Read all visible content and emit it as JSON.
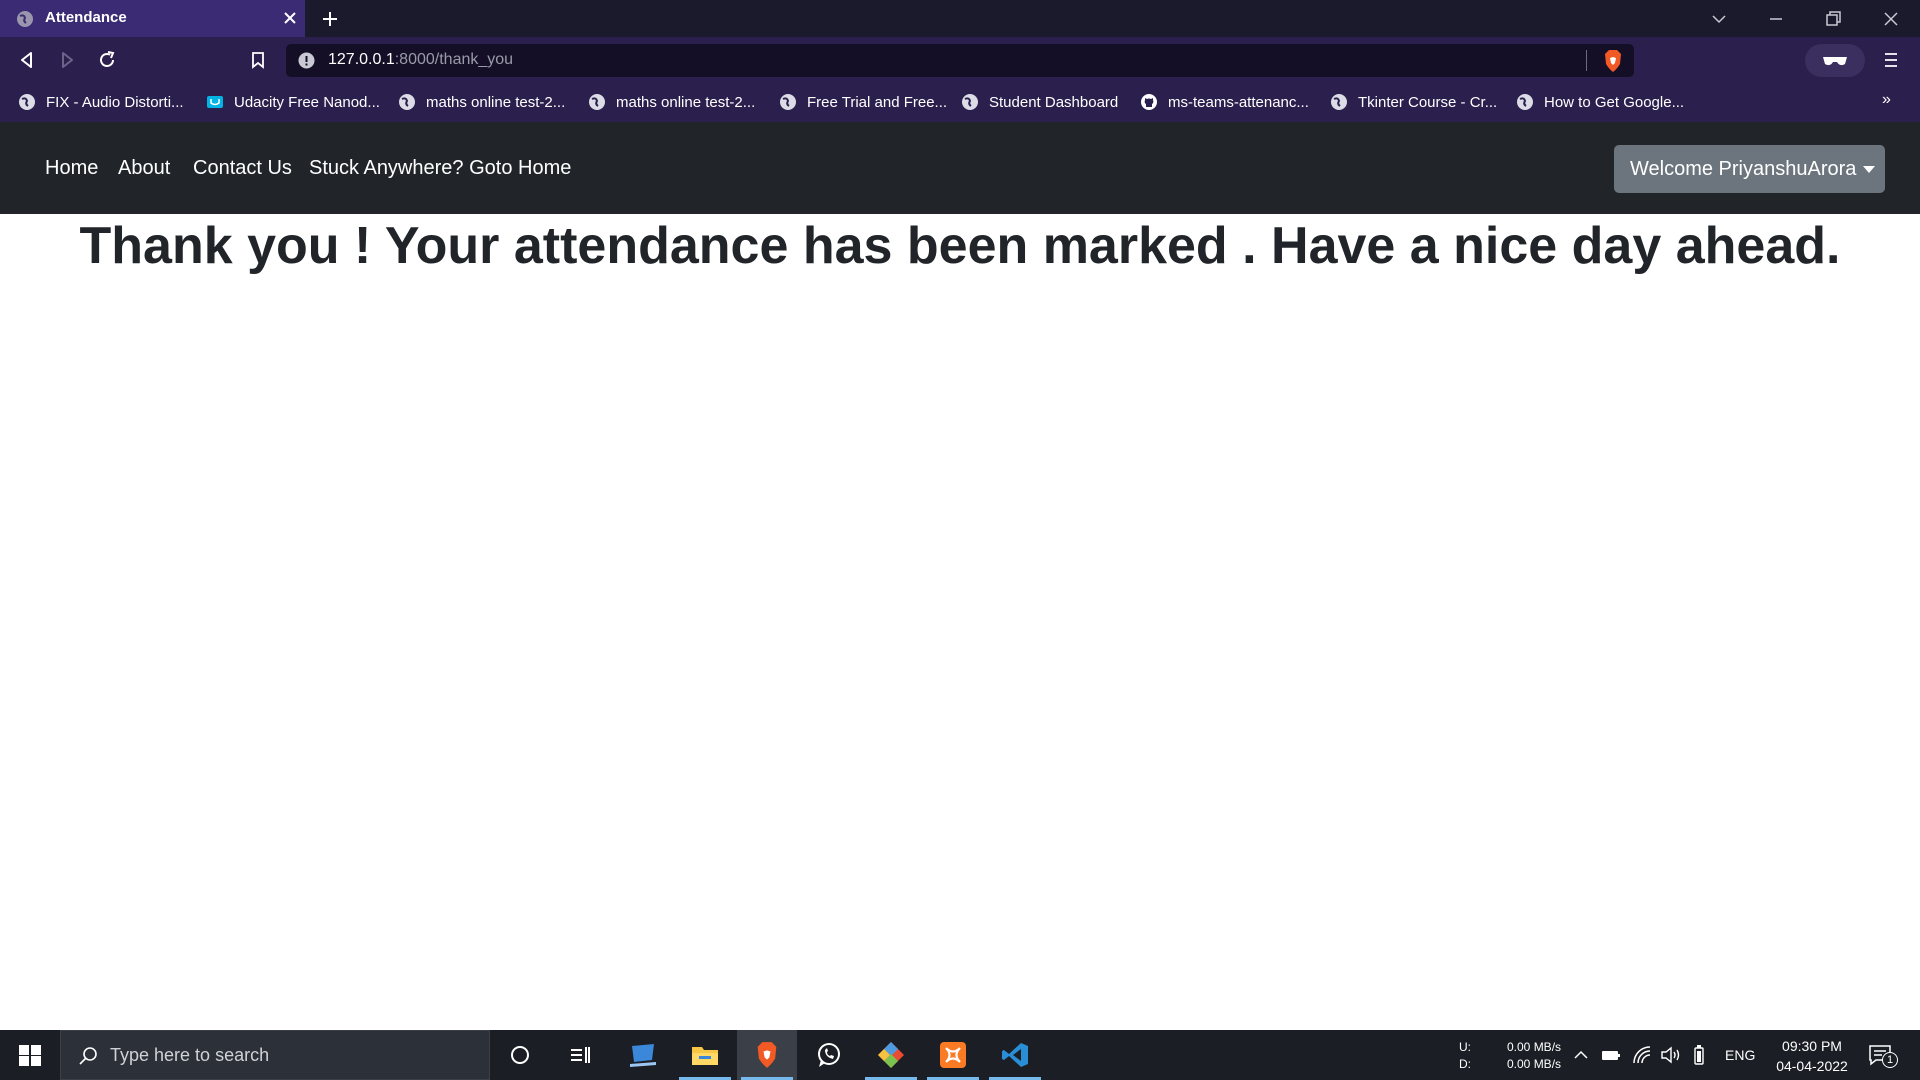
{
  "browser": {
    "tab_title": "Attendance",
    "url_host": "127.0.0.1",
    "url_rest": ":8000/thank_you",
    "bookmarks": [
      "FIX - Audio Distorti...",
      "Udacity Free Nanod...",
      "maths online test-2...",
      "maths online test-2...",
      "Free Trial and Free...",
      "Student Dashboard",
      "ms-teams-attenanc...",
      "Tkinter Course - Cr...",
      "How to Get Google..."
    ],
    "bookmarks_more": "»"
  },
  "navbar": {
    "links": [
      "Home",
      "About",
      "Contact Us",
      "Stuck Anywhere? Goto Home"
    ],
    "welcome": "Welcome PriyanshuArora"
  },
  "main": {
    "message": "Thank you ! Your attendance has been marked . Have a nice day ahead."
  },
  "taskbar": {
    "search_placeholder": "Type here to search",
    "net_up_label": "U:",
    "net_down_label": "D:",
    "net_up": "0.00 MB/s",
    "net_down": "0.00 MB/s",
    "language": "ENG",
    "time": "09:30 PM",
    "date": "04-04-2022",
    "notification_count": "1"
  },
  "colors": {
    "navbar_bg": "#212529",
    "welcome_btn_bg": "#6c757d",
    "tab_active_bg": "#3b2a74",
    "toolbar_bg": "#2b1f4e"
  }
}
